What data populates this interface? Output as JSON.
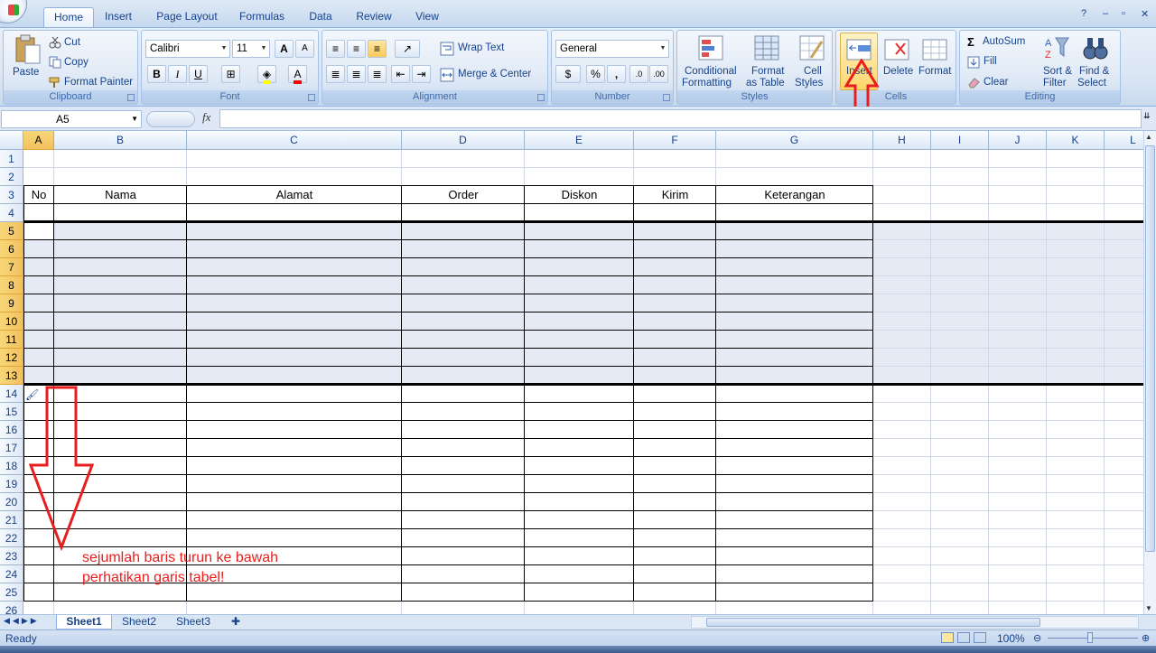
{
  "tabs": [
    "Home",
    "Insert",
    "Page Layout",
    "Formulas",
    "Data",
    "Review",
    "View"
  ],
  "active_tab": "Home",
  "clipboard": {
    "paste": "Paste",
    "cut": "Cut",
    "copy": "Copy",
    "format_painter": "Format Painter",
    "label": "Clipboard"
  },
  "font": {
    "name": "Calibri",
    "size": "11",
    "label": "Font",
    "bold": "B",
    "italic": "I",
    "underline": "U",
    "grow": "A",
    "shrink": "A"
  },
  "alignment": {
    "wrap": "Wrap Text",
    "merge": "Merge & Center",
    "label": "Alignment"
  },
  "number": {
    "format": "General",
    "percent": "%",
    "comma": ",",
    "label": "Number"
  },
  "styles": {
    "cond_l1": "Conditional",
    "cond_l2": "Formatting",
    "fmt_l1": "Format",
    "fmt_l2": "as Table",
    "cell_l1": "Cell",
    "cell_l2": "Styles",
    "label": "Styles"
  },
  "cells": {
    "insert": "Insert",
    "delete": "Delete",
    "format": "Format",
    "label": "Cells"
  },
  "editing": {
    "autosum": "AutoSum",
    "fill": "Fill",
    "clear": "Clear",
    "sort_l1": "Sort &",
    "sort_l2": "Filter",
    "find_l1": "Find &",
    "find_l2": "Select",
    "label": "Editing",
    "sigma": "Σ"
  },
  "formula_bar": {
    "name_box": "A5",
    "fx": "fx",
    "value": ""
  },
  "columns": [
    "A",
    "B",
    "C",
    "D",
    "E",
    "F",
    "G",
    "H",
    "I",
    "J",
    "K",
    "L"
  ],
  "rows": [
    "1",
    "2",
    "3",
    "4",
    "5",
    "6",
    "7",
    "8",
    "9",
    "10",
    "11",
    "12",
    "13",
    "14",
    "15",
    "16",
    "17",
    "18",
    "19",
    "20",
    "21",
    "22",
    "23",
    "24",
    "25",
    "26"
  ],
  "selected_rows": [
    "5",
    "6",
    "7",
    "8",
    "9",
    "10",
    "11",
    "12",
    "13"
  ],
  "selected_column": "A",
  "table_headers": [
    "No",
    "Nama",
    "Alamat",
    "Order",
    "Diskon",
    "Kirim",
    "Keterangan"
  ],
  "sheets": [
    "Sheet1",
    "Sheet2",
    "Sheet3"
  ],
  "active_sheet": "Sheet1",
  "status": {
    "ready": "Ready",
    "zoom": "100%"
  },
  "annotation": {
    "line1": "sejumlah baris turun ke bawah",
    "line2": "perhatikan garis tabel!"
  },
  "colors": {
    "accent": "#15428b",
    "selection": "#e6eaf4",
    "header_selected": "#f1c15f",
    "arrow": "#e81e1e"
  }
}
